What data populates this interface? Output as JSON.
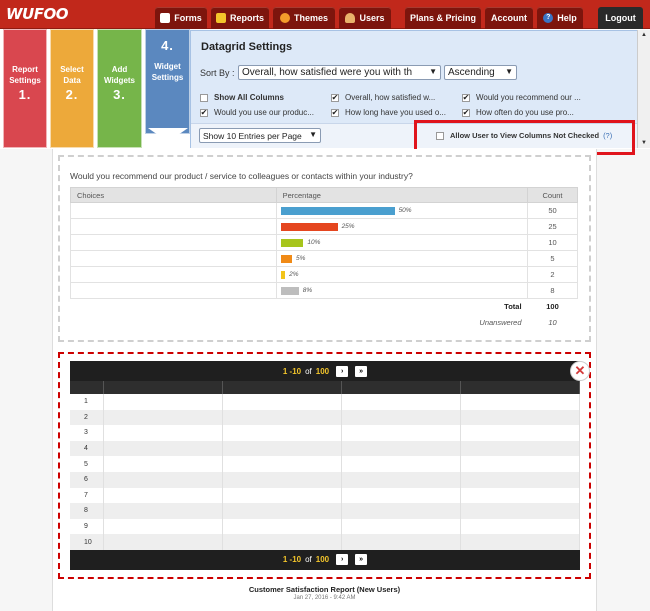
{
  "logo": "WUFOO",
  "nav": {
    "forms": "Forms",
    "reports": "Reports",
    "themes": "Themes",
    "users": "Users",
    "plans": "Plans & Pricing",
    "account": "Account",
    "help": "Help",
    "logout": "Logout"
  },
  "steps": [
    {
      "label1": "Report",
      "label2": "Settings",
      "num": "1.",
      "color": "#d9474f"
    },
    {
      "label1": "Select",
      "label2": "Data",
      "num": "2.",
      "color": "#eda93a"
    },
    {
      "label1": "Add",
      "label2": "Widgets",
      "num": "3.",
      "color": "#76b54a"
    },
    {
      "label1": "Widget",
      "label2": "Settings",
      "num": "4.",
      "color": "#5b88bf"
    }
  ],
  "panel": {
    "title": "Datagrid Settings",
    "sort_label": "Sort By :",
    "sort_value": "Overall, how satisfied were you with th",
    "order_value": "Ascending",
    "columns": [
      {
        "label": "Show All Columns",
        "checked": false
      },
      {
        "label": "Overall, how satisfied w...",
        "checked": true
      },
      {
        "label": "Would you recommend our ...",
        "checked": true
      },
      {
        "label": "Would you use our produc...",
        "checked": true
      },
      {
        "label": "How long have you used o...",
        "checked": true
      },
      {
        "label": "How often do you use pro...",
        "checked": true
      }
    ],
    "entries_value": "Show 10 Entries per Page",
    "allow_label": "Allow User to View Columns Not Checked",
    "allow_help": "(?)"
  },
  "report": {
    "question": "Would you recommend our product / service to colleagues or contacts within your industry?",
    "headers": [
      "Choices",
      "Percentage",
      "Count"
    ],
    "rows": [
      {
        "choice": "",
        "pct": 50,
        "pct_label": "50%",
        "count": "50",
        "color": "#4a9fcf"
      },
      {
        "choice": "",
        "pct": 25,
        "pct_label": "25%",
        "count": "25",
        "color": "#e5461f"
      },
      {
        "choice": "",
        "pct": 10,
        "pct_label": "10%",
        "count": "10",
        "color": "#a7c51c"
      },
      {
        "choice": "",
        "pct": 5,
        "pct_label": "5%",
        "count": "5",
        "color": "#f08a16"
      },
      {
        "choice": "",
        "pct": 2,
        "pct_label": "2%",
        "count": "2",
        "color": "#f2c41a"
      },
      {
        "choice": "",
        "pct": 8,
        "pct_label": "8%",
        "count": "8",
        "color": "#bdbdbd"
      }
    ],
    "total_label": "Total",
    "total_value": "100",
    "unanswered_label": "Unanswered",
    "unanswered_value": "10"
  },
  "datagrid": {
    "range": "1 -10",
    "of": "of",
    "total": "100",
    "next": "›",
    "last": "»",
    "row_numbers": [
      "1",
      "2",
      "3",
      "4",
      "5",
      "6",
      "7",
      "8",
      "9",
      "10"
    ]
  },
  "footer": {
    "title": "Customer Satisfaction Report (New Users)",
    "date": "Jan 27, 2016 - 9:42 AM"
  }
}
